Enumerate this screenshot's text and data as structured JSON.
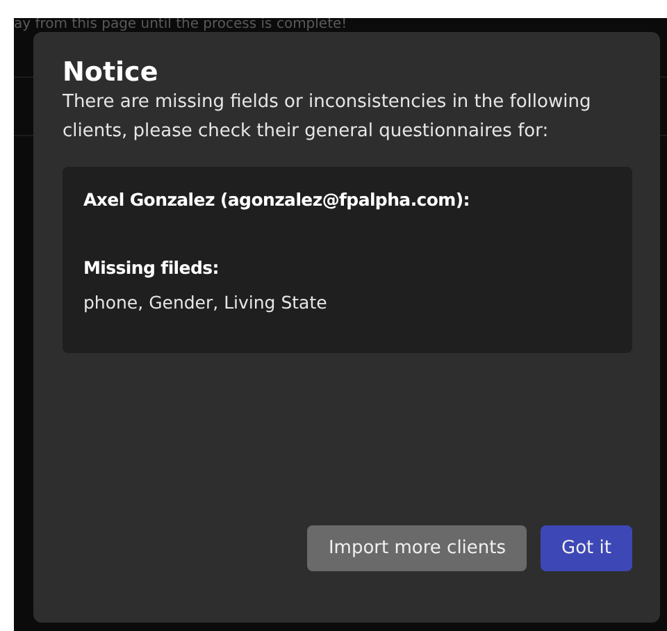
{
  "background_text": "ay from this page until the process is complete!",
  "dialog": {
    "title": "Notice",
    "message": "There are missing fields or inconsistencies in the following clients, please check their general questionnaires for:",
    "clients": [
      {
        "client": "Axel Gonzalez (agonzalez@fpalpha.com):",
        "missing_label": "Missing fileds:",
        "missing_fields": "phone, Gender, Living State"
      }
    ],
    "buttons": [
      {
        "label": "Import more clients",
        "kind": "secondary"
      },
      {
        "label": "Got it",
        "kind": "primary"
      }
    ]
  }
}
